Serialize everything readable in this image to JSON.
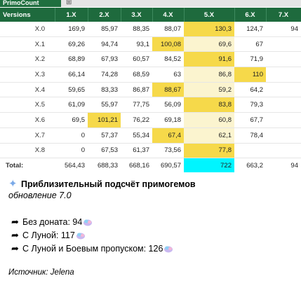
{
  "sheet": {
    "tab_label": "PrimoCount",
    "grid_icon": "grid-icon",
    "headers": [
      "Versions",
      "1.X",
      "2.X",
      "3.X",
      "4.X",
      "5.X",
      "6.X",
      "7.X"
    ],
    "rows": [
      [
        "X.0",
        "169,9",
        "85,97",
        "88,35",
        "88,07",
        "130,3",
        "124,7",
        "94"
      ],
      [
        "X.1",
        "69,26",
        "94,74",
        "93,1",
        "100,08",
        "69,6",
        "67",
        ""
      ],
      [
        "X.2",
        "68,89",
        "67,93",
        "60,57",
        "84,52",
        "91,6",
        "71,9",
        ""
      ],
      [
        "X.3",
        "66,14",
        "74,28",
        "68,59",
        "63",
        "86,8",
        "110",
        ""
      ],
      [
        "X.4",
        "59,65",
        "83,33",
        "86,87",
        "88,67",
        "59,2",
        "64,2",
        ""
      ],
      [
        "X.5",
        "61,09",
        "55,97",
        "77,75",
        "56,09",
        "83,8",
        "79,3",
        ""
      ],
      [
        "X.6",
        "69,5",
        "101,21",
        "76,22",
        "69,18",
        "60,8",
        "67,7",
        ""
      ],
      [
        "X.7",
        "0",
        "57,37",
        "55,34",
        "67,4",
        "62,1",
        "78,4",
        ""
      ],
      [
        "X.8",
        "0",
        "67,53",
        "61,37",
        "73,56",
        "77,8",
        "",
        ""
      ]
    ],
    "total": [
      "Total:",
      "564,43",
      "688,33",
      "668,16",
      "690,57",
      "722",
      "663,2",
      "94"
    ],
    "highlight_color": "#f6d94a",
    "total_highlight_color": "#00f5ff",
    "header_color": "#1e6a3d"
  },
  "message": {
    "title_icon": "sparkle-icon",
    "title": "Приблизительный подсчёт примогемов",
    "subtitle": "обновление 7.0",
    "items": [
      {
        "label": "Без доната: 94",
        "icon": "share-arrow-icon",
        "gem": "primogem-icon"
      },
      {
        "label": "С Луной: 117",
        "icon": "share-arrow-icon",
        "gem": "primogem-icon"
      },
      {
        "label": "С Луной и Боевым пропуском: 126",
        "icon": "share-arrow-icon",
        "gem": "primogem-icon"
      }
    ],
    "source": "Источник: Jelena"
  }
}
